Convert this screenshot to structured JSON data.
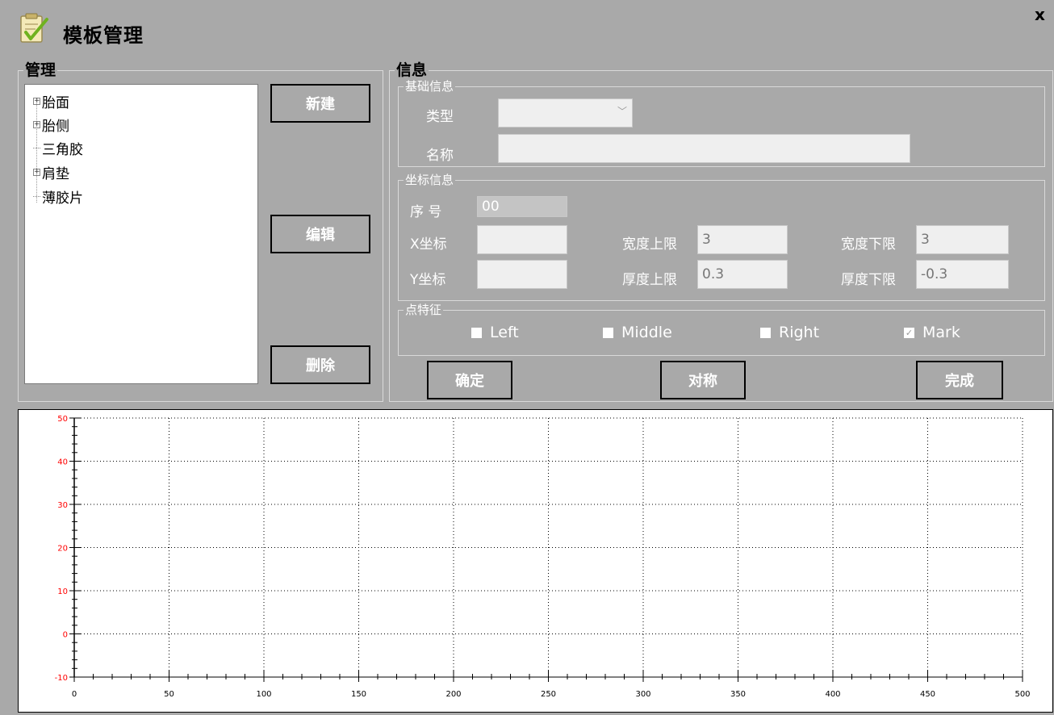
{
  "window": {
    "title": "模板管理",
    "close_label": "x",
    "title_icon": "checklist-pencil-icon"
  },
  "management": {
    "legend": "管理",
    "tree": [
      {
        "label": "胎面",
        "expandable": true
      },
      {
        "label": "胎侧",
        "expandable": true
      },
      {
        "label": "三角胶",
        "expandable": false
      },
      {
        "label": "肩垫",
        "expandable": true
      },
      {
        "label": "薄胶片",
        "expandable": false
      }
    ],
    "buttons": {
      "new": "新建",
      "edit": "编辑",
      "delete": "删除"
    }
  },
  "info": {
    "legend": "信息",
    "basic": {
      "legend": "基础信息",
      "type_label": "类型",
      "type_value": "",
      "name_label": "名称",
      "name_value": ""
    },
    "coords": {
      "legend": "坐标信息",
      "seq_label": "序 号",
      "seq_value": "00",
      "x_label": "X坐标",
      "x_value": "",
      "y_label": "Y坐标",
      "y_value": "",
      "width_upper_label": "宽度上限",
      "width_upper_value": "3",
      "width_lower_label": "宽度下限",
      "width_lower_value": "3",
      "thick_upper_label": "厚度上限",
      "thick_upper_value": "0.3",
      "thick_lower_label": "厚度下限",
      "thick_lower_value": "-0.3"
    },
    "features": {
      "legend": "点特征",
      "items": [
        {
          "label": "Left",
          "checked": false
        },
        {
          "label": "Middle",
          "checked": false
        },
        {
          "label": "Right",
          "checked": false
        },
        {
          "label": "Mark",
          "checked": true
        }
      ]
    },
    "buttons": {
      "confirm": "确定",
      "symmetric": "对称",
      "done": "完成"
    }
  },
  "chart_data": {
    "type": "scatter",
    "series": [],
    "xlim": [
      0,
      500
    ],
    "ylim": [
      -10,
      50
    ],
    "x_ticks": [
      "0",
      "50",
      "100",
      "150",
      "200",
      "250",
      "300",
      "350",
      "400",
      "450",
      "500"
    ],
    "y_ticks": [
      "-10",
      "0",
      "10",
      "20",
      "30",
      "40",
      "50"
    ],
    "grid": true,
    "colors": {
      "y_tick_labels": "#ff0000",
      "x_tick_labels": "#000000",
      "grid": "#000000"
    }
  }
}
